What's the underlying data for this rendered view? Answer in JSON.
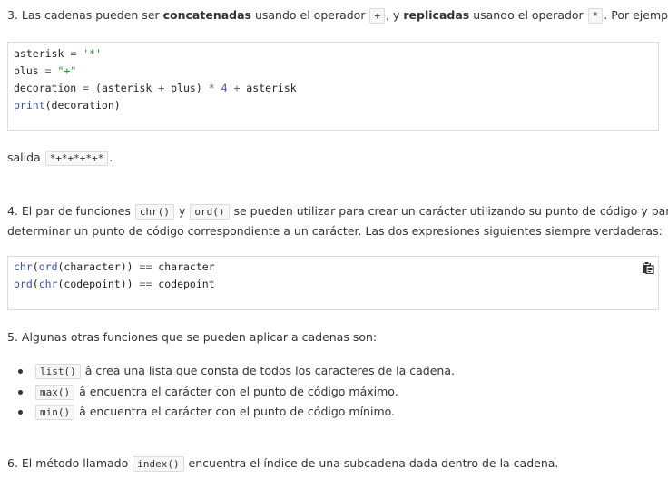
{
  "p3": {
    "prefix": "3. Las cadenas pueden ser ",
    "bold1": "concatenadas",
    "mid1": " usando el operador ",
    "code1": "+",
    "mid2": ", y ",
    "bold2": "replicadas",
    "mid3": " usando el operador ",
    "code2": "*",
    "suffix": ". Por ejemplo:"
  },
  "code_block_1": {
    "lines": [
      {
        "a": "asterisk ",
        "b": "=",
        "c": " ",
        "d": "'*'"
      },
      {
        "a": "plus ",
        "b": "=",
        "c": " ",
        "d": "\"+\""
      },
      {
        "a": "decoration ",
        "b": "=",
        "c": " (asterisk ",
        "d": "+",
        "e": " plus) ",
        "f": "*",
        "g": " ",
        "h": "4",
        "i": " ",
        "j": "+",
        "k": " asterisk"
      },
      {
        "kw": "print",
        "rest": "(decoration)"
      }
    ]
  },
  "output": {
    "label": "salida ",
    "value": "*+*+*+*+*",
    "suffix": "."
  },
  "p4": {
    "prefix": "4. El par de funciones ",
    "code1": "chr()",
    "mid": " y ",
    "code2": "ord()",
    "line1_suffix": " se pueden utilizar para crear un carácter utilizando su punto de código y para",
    "line2": "determinar un punto de código correspondiente a un carácter. Las dos expresiones siguientes siempre verdaderas:"
  },
  "code_block_2": {
    "line1": {
      "f1": "chr",
      "p1": "(",
      "f2": "ord",
      "p2": "(character)) ",
      "op": "==",
      "rest": " character"
    },
    "line2": {
      "f1": "ord",
      "p1": "(",
      "f2": "chr",
      "p2": "(codepoint)) ",
      "op": "==",
      "rest": " codepoint"
    },
    "copy_icon": "clipboard-icon"
  },
  "p5": {
    "text": "5. Algunas otras funciones que se pueden aplicar a cadenas son:"
  },
  "functions": [
    {
      "code": "list()",
      "desc": " â crea una lista que consta de todos los caracteres de la cadena."
    },
    {
      "code": "max()",
      "desc": " â encuentra el carácter con el punto de código máximo."
    },
    {
      "code": "min()",
      "desc": " â encuentra el carácter con el punto de código mínimo."
    }
  ],
  "p6": {
    "prefix": "6. El método llamado ",
    "code": "index()",
    "suffix": " encuentra el índice de una subcadena dada dentro de la cadena."
  }
}
